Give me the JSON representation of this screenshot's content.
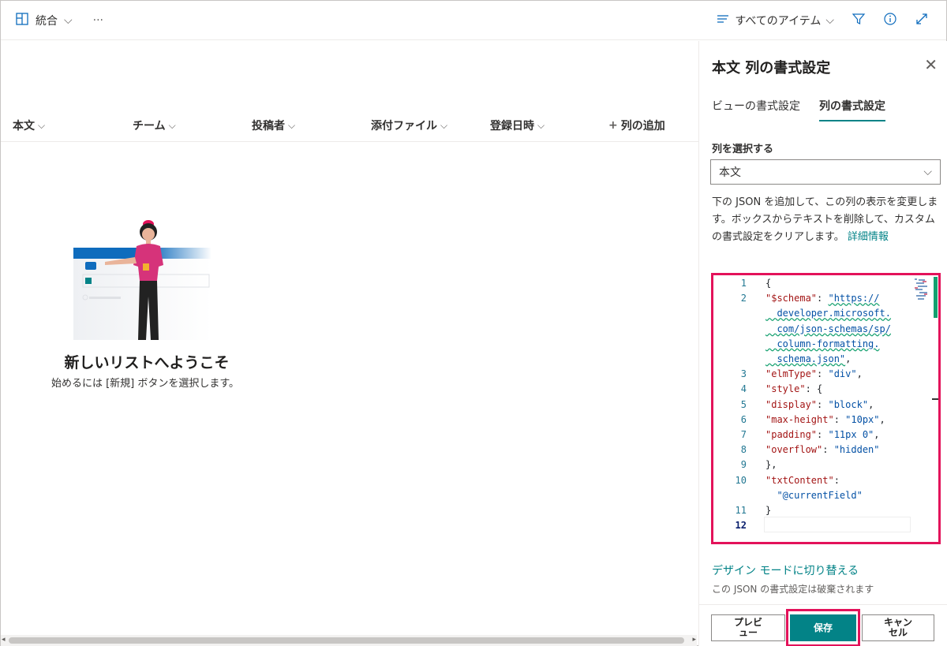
{
  "cmdbar": {
    "view_label": "統合",
    "more_label": "···",
    "filter_label": "すべてのアイテム"
  },
  "columns": [
    "本文",
    "チーム",
    "投稿者",
    "添付ファイル",
    "登録日時"
  ],
  "add_column_label": "列の追加",
  "empty": {
    "title": "新しいリストへようこそ",
    "subtitle": "始めるには [新規] ボタンを選択します。"
  },
  "panel": {
    "title": "本文 列の書式設定",
    "tabs": [
      {
        "label": "ビューの書式設定",
        "active": false
      },
      {
        "label": "列の書式設定",
        "active": true
      }
    ],
    "select_label": "列を選択する",
    "select_value": "本文",
    "description": "下の JSON を追加して、この列の表示を変更します。ボックスからテキストを削除して、カスタムの書式設定をクリアします。",
    "description_link": "詳細情報",
    "design_mode_link": "デザイン モードに切り替える",
    "design_mode_note": "この JSON の書式設定は破棄されます",
    "preview_label": "プレビュー",
    "save_label": "保存",
    "cancel_label": "キャンセル"
  },
  "editor": {
    "lines": [
      {
        "num": "1",
        "segments": [
          {
            "t": "{",
            "c": "p"
          }
        ]
      },
      {
        "num": "2",
        "segments": [
          {
            "t": "\"$schema\"",
            "c": "k"
          },
          {
            "t": ": ",
            "c": "p"
          },
          {
            "t": "\"https://",
            "c": "u"
          }
        ]
      },
      {
        "num": "",
        "segments": [
          {
            "t": "  developer.microsoft.",
            "c": "u"
          }
        ]
      },
      {
        "num": "",
        "segments": [
          {
            "t": "  com/json-schemas/sp/",
            "c": "u"
          }
        ]
      },
      {
        "num": "",
        "segments": [
          {
            "t": "  column-formatting.",
            "c": "u"
          }
        ]
      },
      {
        "num": "",
        "segments": [
          {
            "t": "  schema.json\"",
            "c": "u"
          },
          {
            "t": ",",
            "c": "p"
          }
        ]
      },
      {
        "num": "3",
        "segments": [
          {
            "t": "\"elmType\"",
            "c": "k"
          },
          {
            "t": ": ",
            "c": "p"
          },
          {
            "t": "\"div\"",
            "c": "s"
          },
          {
            "t": ",",
            "c": "p"
          }
        ]
      },
      {
        "num": "4",
        "segments": [
          {
            "t": "\"style\"",
            "c": "k"
          },
          {
            "t": ": {",
            "c": "p"
          }
        ]
      },
      {
        "num": "5",
        "segments": [
          {
            "t": "\"display\"",
            "c": "k"
          },
          {
            "t": ": ",
            "c": "p"
          },
          {
            "t": "\"block\"",
            "c": "s"
          },
          {
            "t": ",",
            "c": "p"
          }
        ]
      },
      {
        "num": "6",
        "segments": [
          {
            "t": "\"max-height\"",
            "c": "k"
          },
          {
            "t": ": ",
            "c": "p"
          },
          {
            "t": "\"10px\"",
            "c": "s"
          },
          {
            "t": ",",
            "c": "p"
          }
        ]
      },
      {
        "num": "7",
        "segments": [
          {
            "t": "\"padding\"",
            "c": "k"
          },
          {
            "t": ": ",
            "c": "p"
          },
          {
            "t": "\"11px 0\"",
            "c": "s"
          },
          {
            "t": ",",
            "c": "p"
          }
        ]
      },
      {
        "num": "8",
        "segments": [
          {
            "t": "\"overflow\"",
            "c": "k"
          },
          {
            "t": ": ",
            "c": "p"
          },
          {
            "t": "\"hidden\"",
            "c": "s"
          }
        ]
      },
      {
        "num": "9",
        "segments": [
          {
            "t": "},",
            "c": "p"
          }
        ]
      },
      {
        "num": "10",
        "segments": [
          {
            "t": "\"txtContent\"",
            "c": "k"
          },
          {
            "t": ":",
            "c": "p"
          }
        ]
      },
      {
        "num": "",
        "segments": [
          {
            "t": "  \"@currentField\"",
            "c": "s"
          }
        ]
      },
      {
        "num": "11",
        "segments": [
          {
            "t": "}",
            "c": "p"
          }
        ]
      },
      {
        "num": "12",
        "segments": []
      }
    ]
  },
  "colors": {
    "accent": "#038387",
    "highlight": "#e3125a"
  }
}
